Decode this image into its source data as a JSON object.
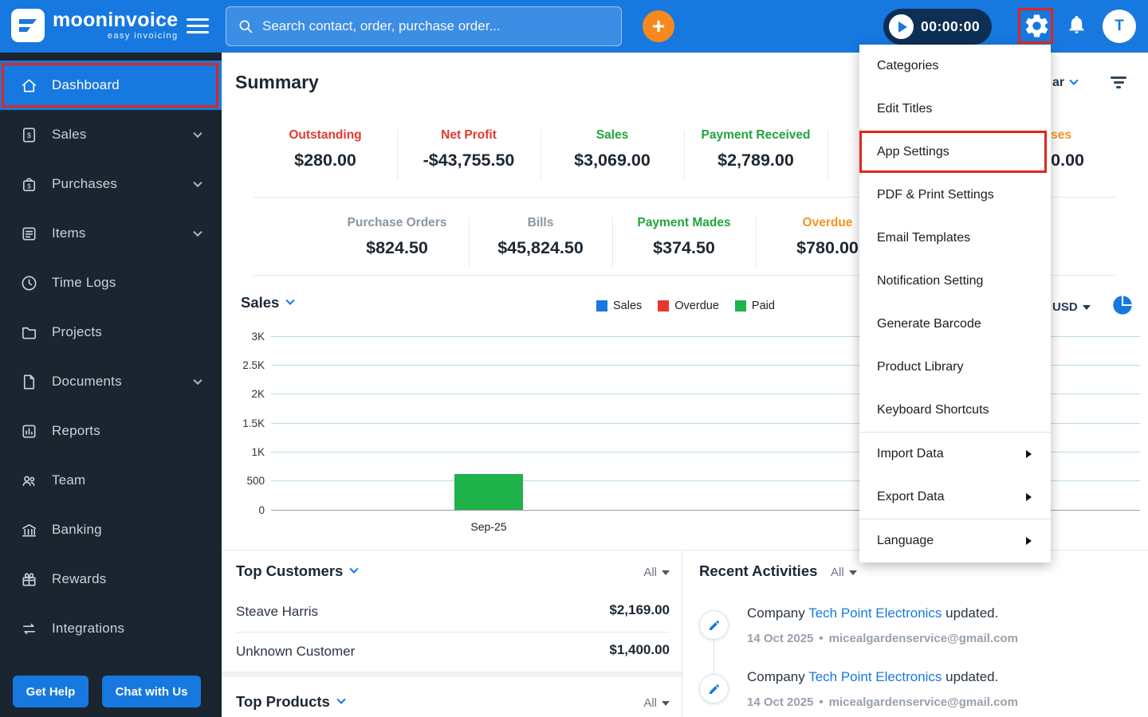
{
  "colors": {
    "brand_blue": "#1778DF",
    "sidebar_dark": "#1A2530",
    "highlight_red": "#E0261C",
    "orange_accent": "#F6891E",
    "bar_green": "#1FB14A"
  },
  "topbar": {
    "brand": {
      "name": "mooninvoice",
      "tagline": "easy invoicing"
    },
    "search": {
      "placeholder": "Search contact, order, purchase order..."
    },
    "add_label": "+",
    "timer": {
      "value": "00:00:00"
    },
    "avatar": {
      "initial": "T"
    }
  },
  "sidebar": {
    "items": [
      {
        "label": "Dashboard",
        "icon": "home",
        "active": true,
        "chevron": false
      },
      {
        "label": "Sales",
        "icon": "invoice-dollar",
        "active": false,
        "chevron": true
      },
      {
        "label": "Purchases",
        "icon": "bag-dollar",
        "active": false,
        "chevron": true
      },
      {
        "label": "Items",
        "icon": "list",
        "active": false,
        "chevron": true
      },
      {
        "label": "Time Logs",
        "icon": "clock",
        "active": false,
        "chevron": false
      },
      {
        "label": "Projects",
        "icon": "folder",
        "active": false,
        "chevron": false
      },
      {
        "label": "Documents",
        "icon": "document",
        "active": false,
        "chevron": true
      },
      {
        "label": "Reports",
        "icon": "bar-chart",
        "active": false,
        "chevron": false
      },
      {
        "label": "Team",
        "icon": "people",
        "active": false,
        "chevron": false
      },
      {
        "label": "Banking",
        "icon": "bank",
        "active": false,
        "chevron": false
      },
      {
        "label": "Rewards",
        "icon": "gift",
        "active": false,
        "chevron": false
      },
      {
        "label": "Integrations",
        "icon": "swap-arrows",
        "active": false,
        "chevron": false
      }
    ],
    "footer": {
      "get_help": "Get Help",
      "chat": "Chat with Us"
    }
  },
  "summary": {
    "title": "Summary",
    "period_fragment": "ar",
    "row1": [
      {
        "label": "Outstanding",
        "value": "$280.00",
        "color": "#E23A2E"
      },
      {
        "label": "Net Profit",
        "value": "-$43,755.50",
        "color": "#E23A2E"
      },
      {
        "label": "Sales",
        "value": "$3,069.00",
        "color": "#1FA53D"
      },
      {
        "label": "Payment Received",
        "value": "$2,789.00",
        "color": "#1FA53D"
      },
      {
        "label": "ses",
        "value": "0.00",
        "color": "#F6921E"
      }
    ],
    "row2": [
      {
        "label": "Purchase Orders",
        "value": "$824.50",
        "color": "#8A96A3"
      },
      {
        "label": "Bills",
        "value": "$45,824.50",
        "color": "#8A96A3"
      },
      {
        "label": "Payment Mades",
        "value": "$374.50",
        "color": "#1FA53D"
      },
      {
        "label": "Overdue",
        "value": "$780.00",
        "color": "#F6921E"
      }
    ]
  },
  "chart_data": {
    "type": "bar",
    "title": "Sales",
    "currency": "USD",
    "categories": [
      "Sep-25"
    ],
    "series": [
      {
        "name": "Sales",
        "color": "#1778DF",
        "values": [
          0
        ]
      },
      {
        "name": "Overdue",
        "color": "#E8392E",
        "values": [
          0
        ]
      },
      {
        "name": "Paid",
        "color": "#1FB14A",
        "values": [
          600
        ]
      }
    ],
    "y_ticks": [
      "3K",
      "2.5K",
      "2K",
      "1.5K",
      "1K",
      "500",
      "0"
    ],
    "ylim": [
      0,
      3000
    ],
    "grid": true,
    "legend_position": "top"
  },
  "top_customers": {
    "title": "Top Customers",
    "filter": "All",
    "rows": [
      {
        "name": "Steave Harris",
        "amount": "$2,169.00"
      },
      {
        "name": "Unknown Customer",
        "amount": "$1,400.00"
      }
    ]
  },
  "top_products": {
    "title": "Top Products",
    "filter": "All"
  },
  "recent_activities": {
    "title": "Recent Activities",
    "filter": "All",
    "entries": [
      {
        "prefix": "Company ",
        "link": "Tech Point Electronics",
        "suffix": " updated.",
        "date": "14 Oct 2025",
        "separator": "•",
        "email": "micealgardenservice@gmail.com"
      },
      {
        "prefix": "Company ",
        "link": "Tech Point Electronics",
        "suffix": " updated.",
        "date": "14 Oct 2025",
        "separator": "•",
        "email": "micealgardenservice@gmail.com"
      }
    ]
  },
  "settings_menu": {
    "items": [
      {
        "label": "Categories",
        "highlighted": false,
        "submenu": false
      },
      {
        "label": "Edit Titles",
        "highlighted": false,
        "submenu": false
      },
      {
        "label": "App Settings",
        "highlighted": true,
        "submenu": false
      },
      {
        "label": "PDF & Print Settings",
        "highlighted": false,
        "submenu": false
      },
      {
        "label": "Email Templates",
        "highlighted": false,
        "submenu": false
      },
      {
        "label": "Notification Setting",
        "highlighted": false,
        "submenu": false
      },
      {
        "label": "Generate Barcode",
        "highlighted": false,
        "submenu": false
      },
      {
        "label": "Product Library",
        "highlighted": false,
        "submenu": false
      },
      {
        "label": "Keyboard Shortcuts",
        "highlighted": false,
        "submenu": false
      },
      {
        "label": "Import Data",
        "highlighted": false,
        "submenu": true
      },
      {
        "label": "Export Data",
        "highlighted": false,
        "submenu": true
      },
      {
        "label": "Language",
        "highlighted": false,
        "submenu": true
      }
    ]
  }
}
